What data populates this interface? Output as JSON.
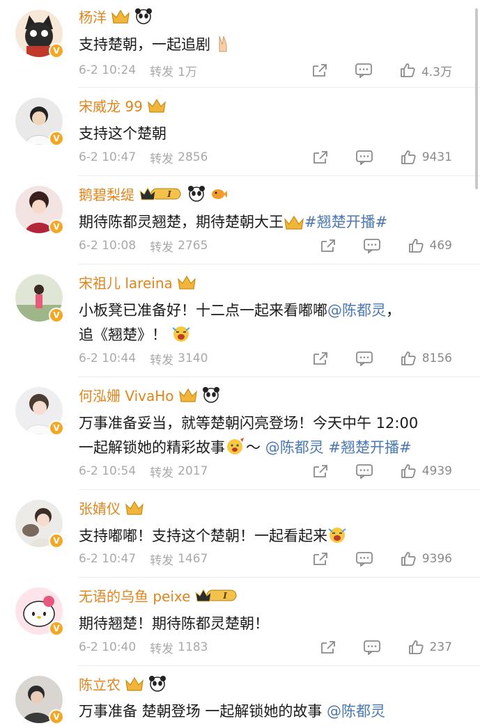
{
  "labels": {
    "repost": "转发"
  },
  "colors": {
    "name": "#e2841a",
    "link": "#4a78b5",
    "meta": "#a9a9a9"
  },
  "comments": [
    {
      "name": "杨洋",
      "text": "支持楚朝，一起追剧",
      "time": "6-2 10:24",
      "reposts": "1万",
      "likes": "4.3万",
      "badges": [
        "crown-badge",
        "panda-icon"
      ],
      "emoji_after": "victory-hand-emoji"
    },
    {
      "name": "宋威龙 99",
      "text": "支持这个楚朝",
      "time": "6-2 10:47",
      "reposts": "2856",
      "likes": "9431",
      "badges": [
        "crown-badge"
      ]
    },
    {
      "name": "鹅碧梨缇",
      "text_a": "期待陈都灵翘楚，期待楚朝大王",
      "tag": "#翘楚开播#",
      "time": "6-2 10:08",
      "reposts": "2765",
      "likes": "469",
      "badges": [
        "level-badge",
        "panda-icon",
        "fish-icon"
      ],
      "emoji_mid": "crown-emoji"
    },
    {
      "name": "宋祖儿 lareina",
      "text_a": "小板凳已准备好！十二点一起来看嘟嘟",
      "mention": "@陈都灵",
      "text_b": "，",
      "text_c": "追《翘楚》！",
      "time": "6-2 10:44",
      "reposts": "3140",
      "likes": "8156",
      "badges": [
        "crown-badge"
      ],
      "emoji_after": "excited-emoji"
    },
    {
      "name": "何泓姗 VivaHo",
      "text_a": "万事准备妥当，就等楚朝闪亮登场！今天中午 12:00",
      "text_b": "一起解锁她的精彩故事",
      "text_c": "～",
      "mention": "@陈都灵",
      "tag": "#翘楚开播#",
      "time": "6-2 10:54",
      "reposts": "2017",
      "likes": "4939",
      "badges": [
        "crown-badge",
        "panda-icon"
      ],
      "emoji_mid": "celebrate-emoji"
    },
    {
      "name": "张婧仪",
      "text": "支持嘟嘟！支持这个楚朝！一起看起来",
      "time": "6-2 10:47",
      "reposts": "1467",
      "likes": "9396",
      "badges": [
        "crown-badge"
      ],
      "emoji_after": "excited-emoji"
    },
    {
      "name": "无语的乌鱼 peixe",
      "text": "期待翘楚！期待陈都灵楚朝！",
      "time": "6-2 10:40",
      "reposts": "1183",
      "likes": "237",
      "badges": [
        "level-badge"
      ]
    },
    {
      "name": "陈立农",
      "text_a": "万事准备 楚朝登场 一起解锁她的故事",
      "mention": "@陈都灵",
      "badges": [
        "crown-badge",
        "panda-icon"
      ]
    }
  ]
}
